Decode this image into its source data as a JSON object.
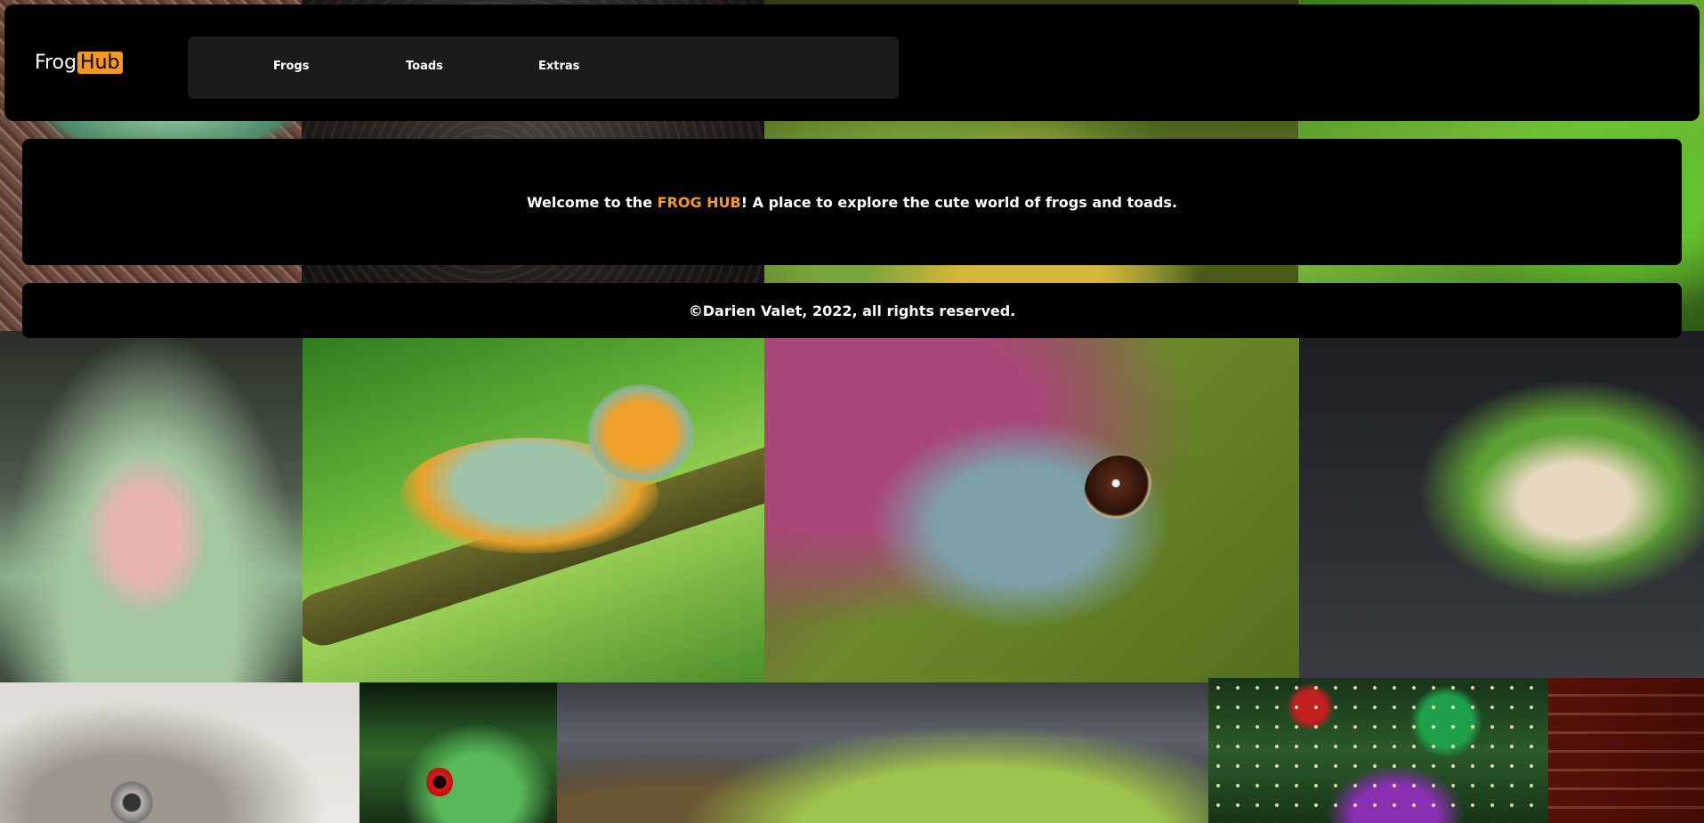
{
  "logo": {
    "part1": "Frog",
    "part2": "Hub"
  },
  "nav": {
    "items": [
      "Frogs",
      "Toads",
      "Extras"
    ]
  },
  "welcome": {
    "prefix": "Welcome to the ",
    "highlight": "FROG HUB",
    "suffix": "! A place to explore the cute world of frogs and toads."
  },
  "footer": {
    "text": "©Darien Valet, 2022, all rights reserved."
  },
  "colors": {
    "accent": "#f7971e",
    "panel": "#000000",
    "nav_bg": "#1b1b1b"
  }
}
